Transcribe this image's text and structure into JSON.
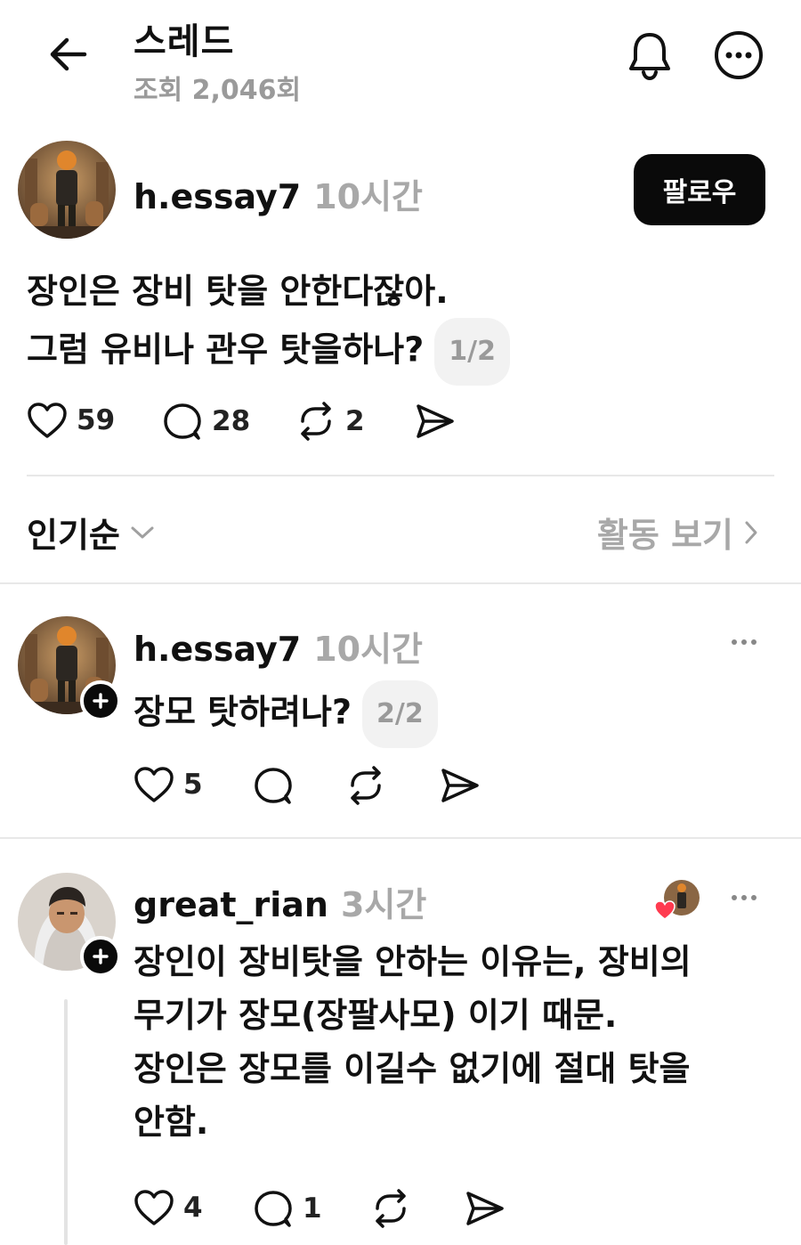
{
  "header": {
    "title": "스레드",
    "views": "조회 2,046회"
  },
  "main_post": {
    "username": "h.essay7",
    "time": "10시간",
    "follow_label": "팔로우",
    "line1": "장인은 장비 탓을 안한다잖아.",
    "line2": "그럼 유비나 관우 탓을하나?",
    "pager": "1/2",
    "likes": "59",
    "comments": "28",
    "reposts": "2"
  },
  "sort": {
    "label": "인기순",
    "activity_label": "활동 보기"
  },
  "reply1": {
    "username": "h.essay7",
    "time": "10시간",
    "text": "장모 탓하려나?",
    "pager": "2/2",
    "likes": "5"
  },
  "reply2": {
    "username": "great_rian",
    "time": "3시간",
    "line1": "장인이 장비탓을 안하는 이유는, 장비의",
    "line2": "무기가 장모(장팔사모) 이기 때문.",
    "line3": "장인은 장모를 이길수 없기에 절대 탓을",
    "line4": "안함.",
    "likes": "4",
    "comments": "1"
  },
  "icons": {
    "back": "arrow-left-icon",
    "bell": "bell-icon",
    "more": "more-circle-icon",
    "like": "heart-icon",
    "comment": "comment-icon",
    "repost": "repost-icon",
    "share": "send-icon"
  },
  "colors": {
    "accent_heart": "#ff3b4f",
    "muted_text": "#a8a8a8",
    "button_bg": "#0a0a0a"
  }
}
